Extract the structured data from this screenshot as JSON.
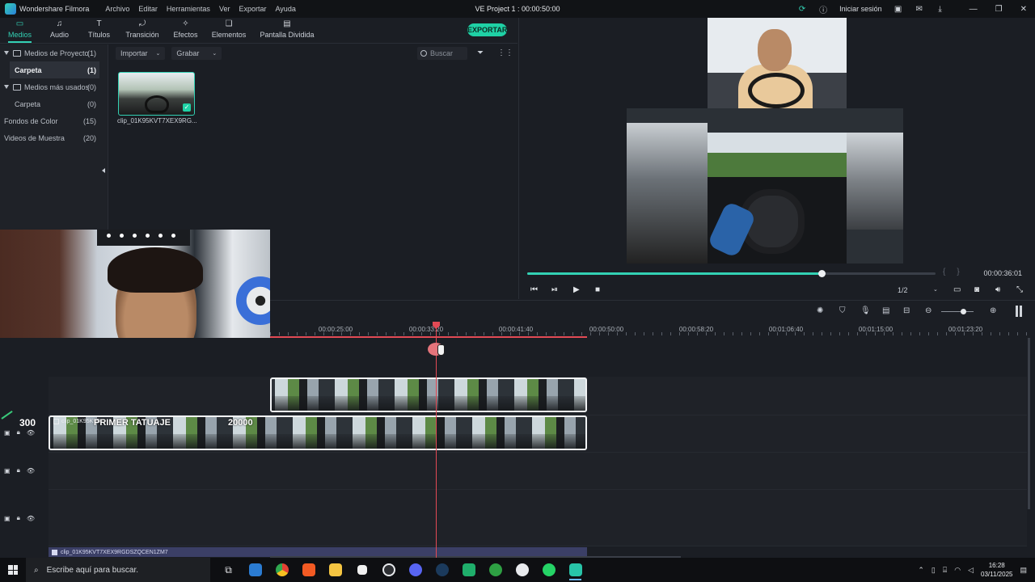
{
  "titlebar": {
    "app_name": "Wondershare Filmora",
    "menu": [
      "Archivo",
      "Editar",
      "Herramientas",
      "Ver",
      "Exportar",
      "Ayuda"
    ],
    "project_title": "VE Project 1 : 00:00:50:00",
    "login_label": "Iniciar sesión"
  },
  "toolbar": {
    "tabs": [
      {
        "label": "Medios",
        "icon": "folder-icon"
      },
      {
        "label": "Audio",
        "icon": "music-note-icon"
      },
      {
        "label": "Títulos",
        "icon": "text-t-icon"
      },
      {
        "label": "Transición",
        "icon": "transition-icon"
      },
      {
        "label": "Efectos",
        "icon": "effects-icon"
      },
      {
        "label": "Elementos",
        "icon": "elements-icon"
      },
      {
        "label": "Pantalla Dividida",
        "icon": "split-screen-icon"
      }
    ],
    "export_label": "EXPORTAR"
  },
  "tree": {
    "items": [
      {
        "label": "Medios de Proyecto",
        "count": "(1)"
      },
      {
        "label": "Carpeta",
        "count": "(1)"
      },
      {
        "label": "Medios más usados",
        "count": "(0)"
      },
      {
        "label": "Carpeta",
        "count": "(0)"
      },
      {
        "label": "Fondos de Color",
        "count": "(15)"
      },
      {
        "label": "Videos de Muestra",
        "count": "(20)"
      }
    ]
  },
  "media": {
    "import_label": "Importar",
    "record_label": "Grabar",
    "search_placeholder": "Buscar",
    "clip_name": "clip_01K95KVT7XEX9RG..."
  },
  "preview": {
    "progress": 0.72,
    "time": "00:00:36:01",
    "ratio": "1/2"
  },
  "timeline": {
    "ruler_labels": [
      "00:00:25:00",
      "00:00:33:20",
      "00:00:41:40",
      "00:00:50:00",
      "00:00:58:20",
      "00:01:06:40",
      "00:01:15:00",
      "00:01:23:20"
    ],
    "clip_short_name": "clip_01K95K9D",
    "overlay_title": "PRIMER TATUAJE",
    "overlay_number": "20000",
    "counter": "300",
    "bottom_clip_name": "clip_01K95KVT7XEX9RGDSZQCEN1ZM7"
  },
  "taskbar": {
    "search_placeholder": "Escribe aquí para buscar.",
    "time": "16:28",
    "date": "03/11/2025"
  },
  "colors": {
    "accent": "#33d1b4",
    "export_button": "#1fd1a5",
    "playhead": "#e24a55"
  }
}
